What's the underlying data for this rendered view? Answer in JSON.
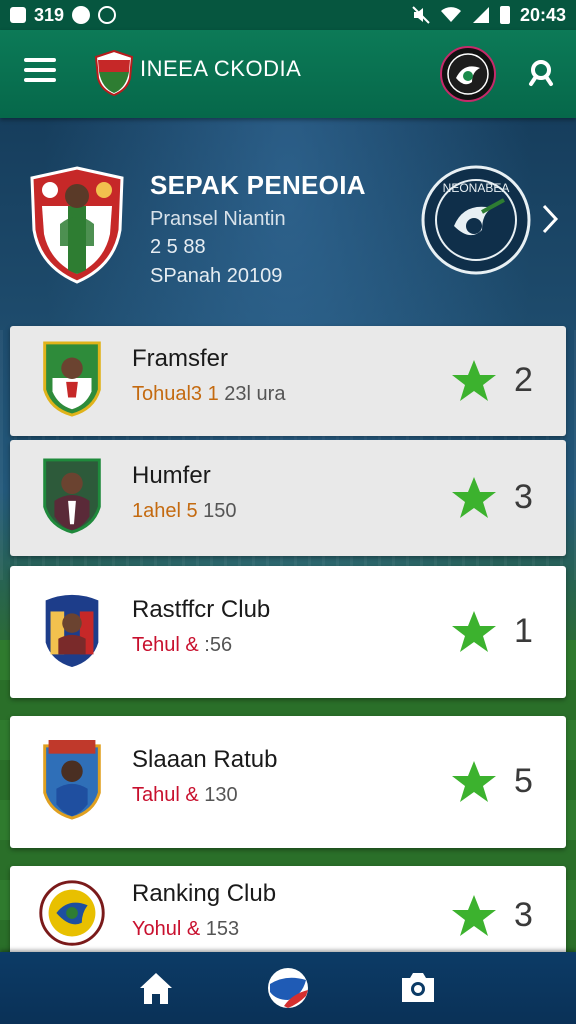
{
  "status_bar": {
    "left_text": "319",
    "time": "20:43"
  },
  "app_bar": {
    "title": "INEEA CKODIA",
    "menu_icon": "menu-icon",
    "search_icon": "search-icon"
  },
  "header": {
    "title": "SEPAK PENEOIA",
    "subtitle": "Pransel Niantin",
    "number": "2 5 88",
    "date": "SPanah 20109",
    "badge_text": "NEONABEA"
  },
  "clubs": [
    {
      "name": "Framsfer",
      "meta_a": "Tohual3 1",
      "meta_b": " 23l ura",
      "rank": "2",
      "meta_color": "#c46a10"
    },
    {
      "name": "Humfer",
      "meta_a": "1ahel 5",
      "meta_b": " 150",
      "rank": "3",
      "meta_color": "#c46a10"
    },
    {
      "name": "Rastffcr Club",
      "meta_a": "Tehul & ",
      "meta_b": ":56",
      "rank": "1",
      "meta_color": "#c8102e"
    },
    {
      "name": "Slaaan Ratub",
      "meta_a": "Tahul & ",
      "meta_b": "130",
      "rank": "5",
      "meta_color": "#c8102e"
    },
    {
      "name": "Ranking Club",
      "meta_a": "Yohul & ",
      "meta_b": "153",
      "rank": "3",
      "meta_color": "#c8102e"
    }
  ],
  "colors": {
    "appbar": "#0c7a57",
    "star": "#3cb22e",
    "bottom_nav": "#0c3b66"
  },
  "bottom_nav": [
    "home-icon",
    "ball-icon",
    "camera-icon"
  ]
}
